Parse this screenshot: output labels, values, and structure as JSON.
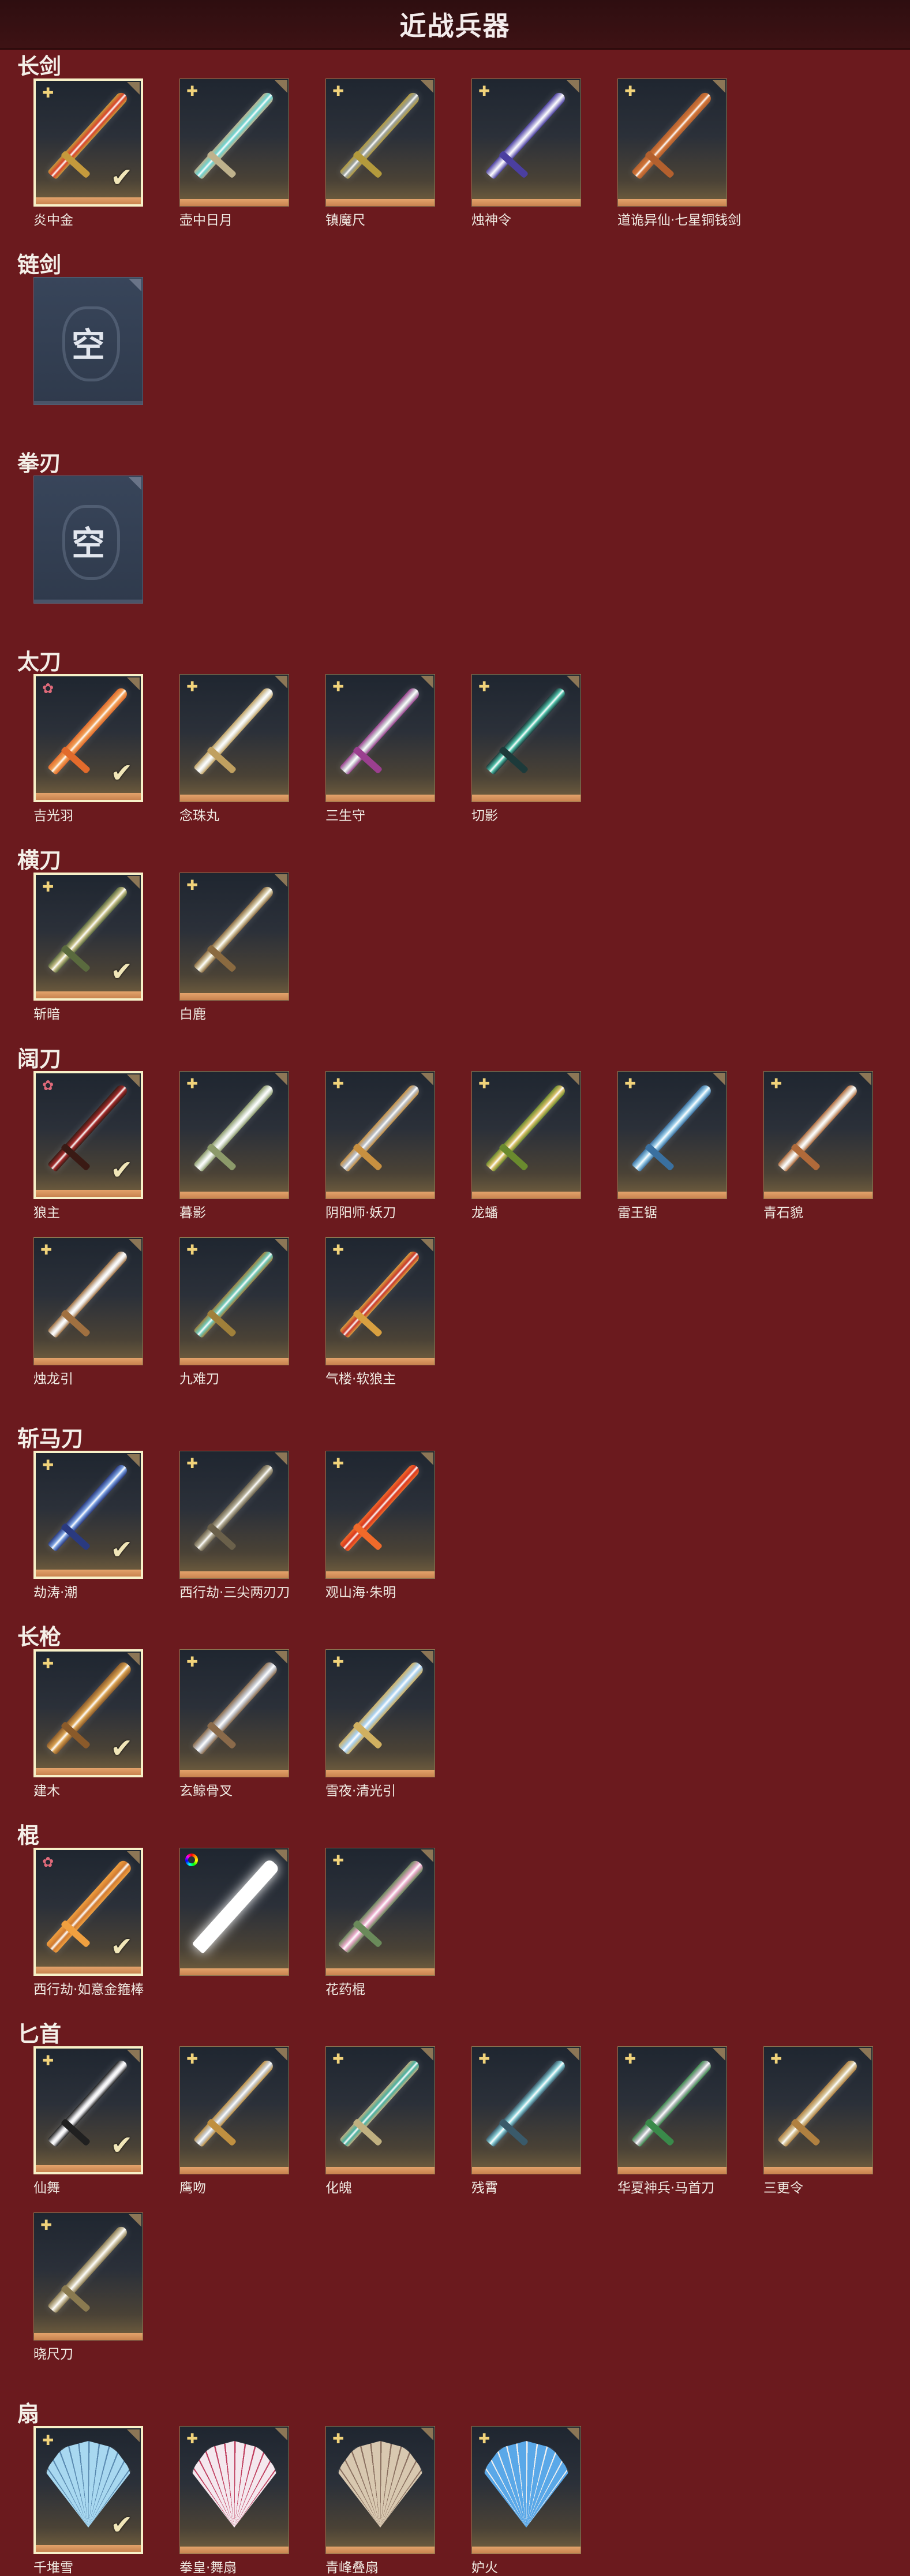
{
  "title": "近战兵器",
  "empty_label": "空",
  "sections": [
    {
      "name": "长剑",
      "items": [
        {
          "label": "炎中金",
          "rank": "gold",
          "selected": true,
          "color": "#d8442a",
          "guard": "#c59a3c"
        },
        {
          "label": "壶中日月",
          "rank": "gold",
          "selected": false,
          "color": "#6fd2cf",
          "guard": "#bfb28c"
        },
        {
          "label": "镇魔尺",
          "rank": "gold",
          "selected": false,
          "color": "#9aa09a",
          "guard": "#b39a3c"
        },
        {
          "label": "烛神令",
          "rank": "gold",
          "selected": false,
          "color": "#c8c4e6",
          "guard": "#4b3fa0"
        },
        {
          "label": "道诡异仙·七星铜钱剑",
          "rank": "gold",
          "selected": false,
          "color": "#d1763a",
          "guard": "#b3602e"
        }
      ]
    },
    {
      "name": "链剑",
      "empty": true,
      "items": []
    },
    {
      "name": "拳刃",
      "empty": true,
      "items": []
    },
    {
      "name": "太刀",
      "items": [
        {
          "label": "吉光羽",
          "rank": "red",
          "selected": true,
          "color": "#f0a058",
          "guard": "#e26b2c"
        },
        {
          "label": "念珠丸",
          "rank": "gold",
          "selected": false,
          "color": "#e8e8e0",
          "guard": "#c0a060"
        },
        {
          "label": "三生守",
          "rank": "gold",
          "selected": false,
          "color": "#cfd0d6",
          "guard": "#9b3f8f"
        },
        {
          "label": "切影",
          "rank": "gold",
          "selected": false,
          "color": "#4fbfa8",
          "guard": "#1d3a3a"
        }
      ]
    },
    {
      "name": "横刀",
      "items": [
        {
          "label": "斩暗",
          "rank": "gold",
          "selected": true,
          "color": "#c7c08a",
          "guard": "#5a6a3e"
        },
        {
          "label": "白鹿",
          "rank": "gold",
          "selected": false,
          "color": "#d9cfae",
          "guard": "#8a6a40"
        }
      ]
    },
    {
      "name": "阔刀",
      "items": [
        {
          "label": "狼主",
          "rank": "red",
          "selected": true,
          "color": "#a02a2a",
          "guard": "#3a1a14"
        },
        {
          "label": "暮影",
          "rank": "gold",
          "selected": false,
          "color": "#dfe6dc",
          "guard": "#8c9a6a"
        },
        {
          "label": "阴阳师·妖刀",
          "rank": "gold",
          "selected": false,
          "color": "#b8bcc2",
          "guard": "#c89040"
        },
        {
          "label": "龙蟠",
          "rank": "gold",
          "selected": false,
          "color": "#d9c06a",
          "guard": "#6a8a2e"
        },
        {
          "label": "雷王锯",
          "rank": "gold",
          "selected": false,
          "color": "#9fd0ea",
          "guard": "#3a70a0"
        },
        {
          "label": "青石貌",
          "rank": "gold",
          "selected": false,
          "color": "#e6dcd0",
          "guard": "#b06a3a"
        },
        {
          "label": "烛龙引",
          "rank": "gold",
          "selected": false,
          "color": "#e8e4e0",
          "guard": "#a07040"
        },
        {
          "label": "九难刀",
          "rank": "gold",
          "selected": false,
          "color": "#6fc8b8",
          "guard": "#a0803a"
        },
        {
          "label": "气楼·软狼主",
          "rank": "gold",
          "selected": false,
          "color": "#c8382a",
          "guard": "#d8a040"
        }
      ]
    },
    {
      "name": "斩马刀",
      "items": [
        {
          "label": "劫涛·潮",
          "rank": "gold",
          "selected": true,
          "color": "#7aa0e0",
          "guard": "#2a3a80"
        },
        {
          "label": "西行劫·三尖两刃刀",
          "rank": "gold",
          "selected": false,
          "color": "#b6b09a",
          "guard": "#6a604a"
        },
        {
          "label": "观山海·朱明",
          "rank": "gold",
          "selected": false,
          "color": "#d8381e",
          "guard": "#f06a2a"
        }
      ]
    },
    {
      "name": "长枪",
      "items": [
        {
          "label": "建木",
          "rank": "gold",
          "selected": true,
          "color": "#d8a050",
          "guard": "#8a5a2a"
        },
        {
          "label": "玄鲸骨叉",
          "rank": "gold",
          "selected": false,
          "color": "#c8ccd4",
          "guard": "#8a6a4a"
        },
        {
          "label": "雪夜·清光引",
          "rank": "gold",
          "selected": false,
          "color": "#a8d0f0",
          "guard": "#d0b060"
        }
      ]
    },
    {
      "name": "棍",
      "items": [
        {
          "label": "西行劫·如意金箍棒",
          "rank": "red",
          "selected": true,
          "color": "#d07a30",
          "guard": "#f0a040"
        },
        {
          "label": "",
          "rank": "rainbow",
          "selected": false,
          "color": "#ffffff",
          "guard": "#ffffff",
          "glow": true
        },
        {
          "label": "花药棍",
          "rank": "gold",
          "selected": false,
          "color": "#e8a8c8",
          "guard": "#6a8a5a"
        }
      ]
    },
    {
      "name": "匕首",
      "items": [
        {
          "label": "仙舞",
          "rank": "gold",
          "selected": true,
          "color": "#e0e0e4",
          "guard": "#202020"
        },
        {
          "label": "鹰吻",
          "rank": "gold",
          "selected": false,
          "color": "#c8ccd0",
          "guard": "#c09040"
        },
        {
          "label": "化魄",
          "rank": "gold",
          "selected": false,
          "color": "#4ab0a0",
          "guard": "#c0b080"
        },
        {
          "label": "残霄",
          "rank": "gold",
          "selected": false,
          "color": "#8ad0d8",
          "guard": "#3a5a6a"
        },
        {
          "label": "华夏神兵·马首刀",
          "rank": "gold",
          "selected": false,
          "color": "#b8bcc0",
          "guard": "#3a8a4a"
        },
        {
          "label": "三更令",
          "rank": "gold",
          "selected": false,
          "color": "#d8c8a0",
          "guard": "#b08040"
        },
        {
          "label": "晓尺刀",
          "rank": "gold",
          "selected": false,
          "color": "#d8d0b8",
          "guard": "#8a7a50"
        }
      ]
    },
    {
      "name": "扇",
      "items": [
        {
          "label": "千堆雪",
          "rank": "gold",
          "selected": true,
          "color": "#a8d8f0",
          "guard": "#5a8ab0",
          "fan": true
        },
        {
          "label": "拳皇·舞扇",
          "rank": "gold",
          "selected": false,
          "color": "#f4e8ee",
          "guard": "#c04060",
          "fan": true
        },
        {
          "label": "青峰叠扇",
          "rank": "gold",
          "selected": false,
          "color": "#d8c8b0",
          "guard": "#8a7060",
          "fan": true
        },
        {
          "label": "妒火",
          "rank": "gold",
          "selected": false,
          "color": "#5aa8e8",
          "guard": "#f0f0f0",
          "fan": true
        }
      ]
    }
  ]
}
